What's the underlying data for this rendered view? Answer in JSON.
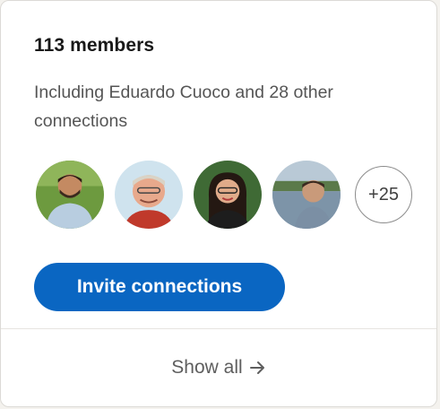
{
  "group": {
    "members_title": "113 members",
    "connections_text": "Including Eduardo Cuoco and 28 other connections",
    "more_count": "+25",
    "avatars": [
      {
        "icon": "member-photo-1",
        "accent": "#5f8a3a"
      },
      {
        "icon": "member-photo-2",
        "accent": "#c9dde8"
      },
      {
        "icon": "member-photo-3",
        "accent": "#3d5f33"
      },
      {
        "icon": "member-photo-4",
        "accent": "#6c7f90"
      }
    ]
  },
  "actions": {
    "invite_label": "Invite connections",
    "show_all_label": "Show all"
  },
  "colors": {
    "primary": "#0a66c2",
    "text_primary": "#191919",
    "text_secondary": "#555555",
    "background": "#f4f2ee"
  }
}
